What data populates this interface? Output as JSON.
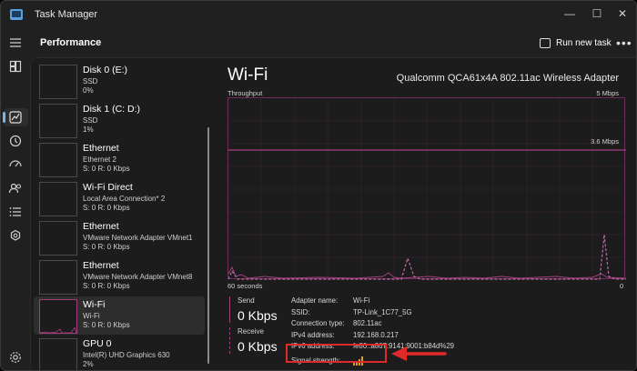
{
  "window": {
    "title": "Task Manager",
    "controls": {
      "minimize": "—",
      "maximize": "☐",
      "close": "✕"
    }
  },
  "header": {
    "title": "Performance",
    "run_task_label": "Run new task",
    "more_label": "•••"
  },
  "rail": {
    "icons": [
      "menu-icon",
      "processes-icon",
      "performance-icon",
      "app-history-icon",
      "startup-apps-icon",
      "users-icon",
      "details-icon",
      "services-icon",
      "settings-icon"
    ]
  },
  "devices": [
    {
      "name": "Disk 0 (E:)",
      "sub1": "SSD",
      "sub2": "0%"
    },
    {
      "name": "Disk 1 (C: D:)",
      "sub1": "SSD",
      "sub2": "1%"
    },
    {
      "name": "Ethernet",
      "sub1": "Ethernet 2",
      "sub2": "S: 0  R: 0 Kbps"
    },
    {
      "name": "Wi-Fi Direct",
      "sub1": "Local Area Connection* 2",
      "sub2": "S: 0  R: 0 Kbps"
    },
    {
      "name": "Ethernet",
      "sub1": "VMware Network Adapter VMnet1",
      "sub2": "S: 0  R: 0 Kbps"
    },
    {
      "name": "Ethernet",
      "sub1": "VMware Network Adapter VMnet8",
      "sub2": "S: 0  R: 0 Kbps"
    },
    {
      "name": "Wi-Fi",
      "sub1": "Wi-Fi",
      "sub2": "S: 0  R: 0 Kbps"
    },
    {
      "name": "GPU 0",
      "sub1": "Intel(R) UHD Graphics 630",
      "sub2": "2%"
    }
  ],
  "detail": {
    "title": "Wi-Fi",
    "adapter": "Qualcomm QCA61x4A 802.11ac Wireless Adapter",
    "throughput_label": "Throughput",
    "max_label": "5 Mbps",
    "line_label": "3.6 Mbps",
    "time_label": "60 seconds",
    "zero_label": "0",
    "send_label": "Send",
    "send_value": "0 Kbps",
    "receive_label": "Receive",
    "receive_value": "0 Kbps",
    "properties": [
      {
        "key": "Adapter name:",
        "value": "Wi-Fi"
      },
      {
        "key": "SSID:",
        "value": "TP-Link_1C77_5G"
      },
      {
        "key": "Connection type:",
        "value": "802.11ac"
      },
      {
        "key": "IPv4 address:",
        "value": "192.168.0.217"
      },
      {
        "key": "IPv6 address:",
        "value": "fe80::a867:9141:9001:b84d%29"
      },
      {
        "key": "Signal strength:",
        "value": ""
      }
    ]
  },
  "colors": {
    "accent": "#a2407f",
    "annotation": "#e02a2a",
    "signal": "#e0a030"
  }
}
